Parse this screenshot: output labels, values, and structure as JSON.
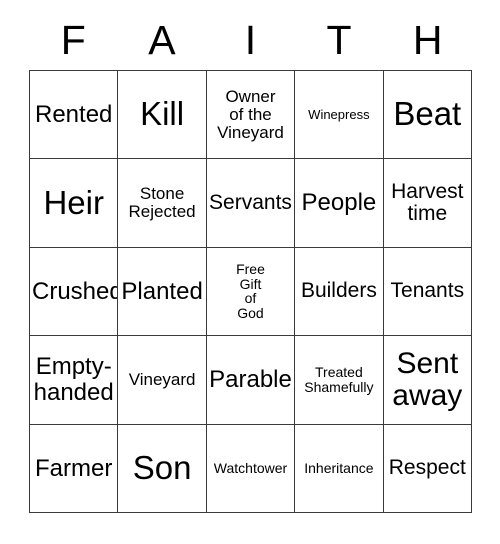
{
  "card": {
    "header_letters": [
      "F",
      "A",
      "I",
      "T",
      "H"
    ],
    "rows": [
      [
        {
          "text": "Rented",
          "size": "md"
        },
        {
          "text": "Kill",
          "size": "xl"
        },
        {
          "text": "Owner\nof the\nVineyard",
          "size": "xs"
        },
        {
          "text": "Winepress",
          "size": "tiny"
        },
        {
          "text": "Beat",
          "size": "xl"
        }
      ],
      [
        {
          "text": "Heir",
          "size": "xl"
        },
        {
          "text": "Stone\nRejected",
          "size": "xs"
        },
        {
          "text": "Servants",
          "size": "sm"
        },
        {
          "text": "People",
          "size": "md"
        },
        {
          "text": "Harvest\ntime",
          "size": "sm"
        }
      ],
      [
        {
          "text": "Crushed",
          "size": "md"
        },
        {
          "text": "Planted",
          "size": "md"
        },
        {
          "text": "Free\nGift\nof\nGod",
          "size": "xxs"
        },
        {
          "text": "Builders",
          "size": "sm"
        },
        {
          "text": "Tenants",
          "size": "sm"
        }
      ],
      [
        {
          "text": "Empty-\nhanded",
          "size": "md"
        },
        {
          "text": "Vineyard",
          "size": "xs"
        },
        {
          "text": "Parable",
          "size": "md"
        },
        {
          "text": "Treated\nShamefully",
          "size": "xxs"
        },
        {
          "text": "Sent\naway",
          "size": "lg"
        }
      ],
      [
        {
          "text": "Farmer",
          "size": "md"
        },
        {
          "text": "Son",
          "size": "xl"
        },
        {
          "text": "Watchtower",
          "size": "xxs"
        },
        {
          "text": "Inheritance",
          "size": "xxs"
        },
        {
          "text": "Respect",
          "size": "sm"
        }
      ]
    ]
  },
  "colors": {
    "background": "#ffffff",
    "text": "#000000",
    "grid_line": "#3a3a3a"
  }
}
